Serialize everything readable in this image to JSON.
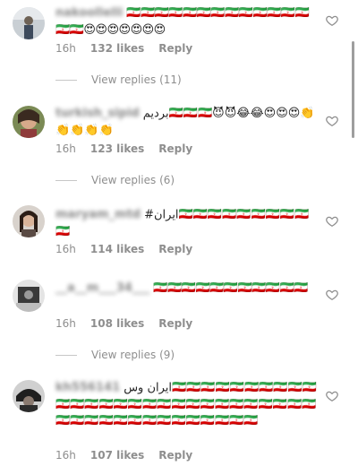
{
  "comments": [
    {
      "username": "nakoollelli",
      "text": "🇮🇷🇮🇷🇮🇷🇮🇷🇮🇷🇮🇷🇮🇷🇮🇷🇮🇷🇮🇷🇮🇷🇮🇷🇮🇷🇮🇷🇮🇷😍😍😍😍😍😍😍",
      "time": "16h",
      "likes": "132 likes",
      "reply": "Reply",
      "view_replies": "View replies (11)"
    },
    {
      "username": "turkish_sipid",
      "text_rtl": "بردیم",
      "text": "🇮🇷🇮🇷🇮🇷😈😈😂😂😍😍😍👏👏👏👏👏",
      "time": "16h",
      "likes": "123 likes",
      "reply": "Reply",
      "view_replies": "View replies (6)"
    },
    {
      "username": "maryam_mtd",
      "text_rtl": "ایران#",
      "text": "🇮🇷🇮🇷🇮🇷🇮🇷🇮🇷🇮🇷🇮🇷🇮🇷🇮🇷🇮🇷",
      "time": "16h",
      "likes": "114 likes",
      "reply": "Reply"
    },
    {
      "username": "__a__m___34___",
      "text": "🇮🇷🇮🇷🇮🇷🇮🇷🇮🇷🇮🇷🇮🇷🇮🇷🇮🇷🇮🇷🇮🇷",
      "time": "16h",
      "likes": "108 likes",
      "reply": "Reply",
      "view_replies": "View replies (9)"
    },
    {
      "username": "kh556141",
      "text_rtl": "ایران وس",
      "text": "🇮🇷🇮🇷🇮🇷🇮🇷🇮🇷🇮🇷🇮🇷🇮🇷🇮🇷🇮🇷🇮🇷🇮🇷🇮🇷🇮🇷🇮🇷🇮🇷🇮🇷🇮🇷🇮🇷🇮🇷🇮🇷🇮🇷🇮🇷🇮🇷🇮🇷🇮🇷🇮🇷🇮🇷🇮🇷🇮🇷🇮🇷🇮🇷🇮🇷🇮🇷🇮🇷🇮🇷🇮🇷🇮🇷🇮🇷🇮🇷🇮🇷🇮🇷",
      "time": "16h",
      "likes": "107 likes",
      "reply": "Reply"
    }
  ],
  "icons": {
    "like": "heart-outline-icon",
    "avatar": "avatar-photo"
  },
  "colors": {
    "text": "#262626",
    "meta": "#8e8e8e",
    "background": "#ffffff",
    "divider": "#c7c7c7"
  }
}
